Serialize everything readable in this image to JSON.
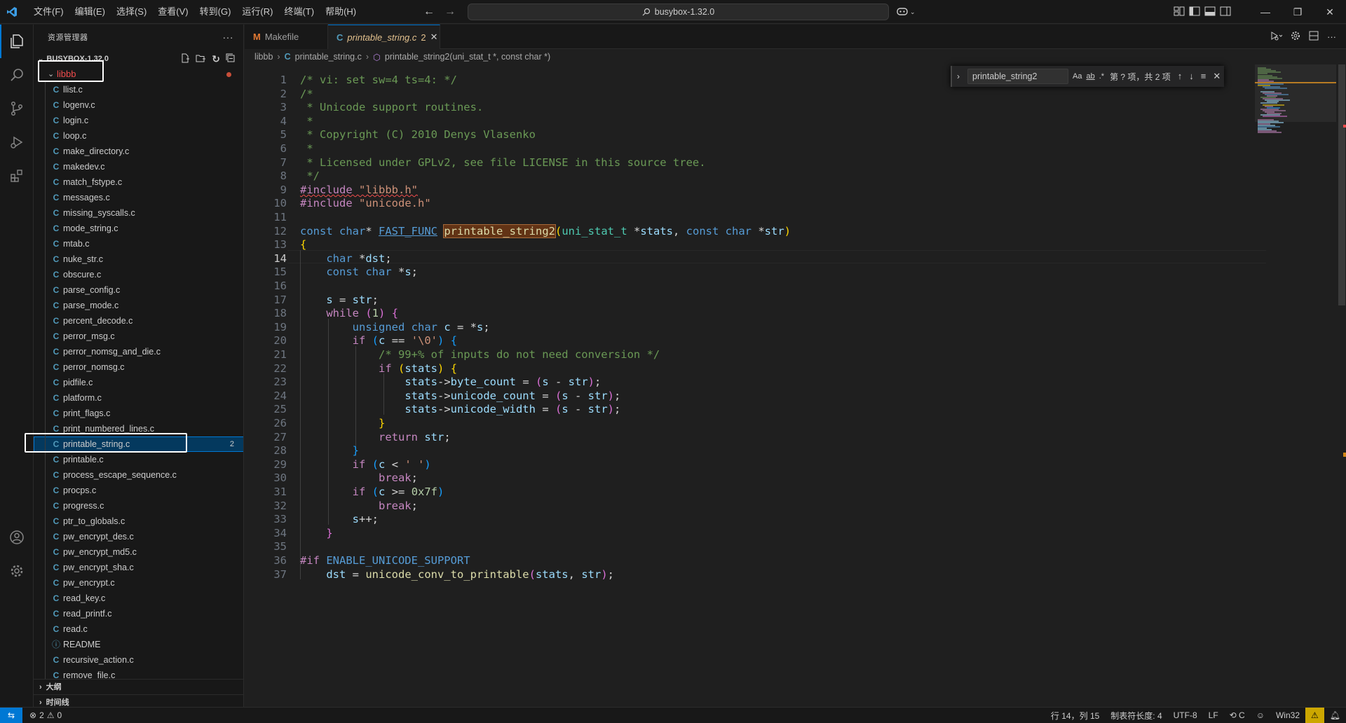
{
  "menu": [
    "文件(F)",
    "编辑(E)",
    "选择(S)",
    "查看(V)",
    "转到(G)",
    "运行(R)",
    "终端(T)",
    "帮助(H)"
  ],
  "command_center": {
    "text": "busybox-1.32.0"
  },
  "sidebar": {
    "title": "资源管理器",
    "root_folder": "BUSYBOX-1.32.0",
    "folder": "libbb",
    "files": [
      {
        "name": "llist.c",
        "type": "c"
      },
      {
        "name": "logenv.c",
        "type": "c"
      },
      {
        "name": "login.c",
        "type": "c"
      },
      {
        "name": "loop.c",
        "type": "c"
      },
      {
        "name": "make_directory.c",
        "type": "c"
      },
      {
        "name": "makedev.c",
        "type": "c"
      },
      {
        "name": "match_fstype.c",
        "type": "c"
      },
      {
        "name": "messages.c",
        "type": "c"
      },
      {
        "name": "missing_syscalls.c",
        "type": "c"
      },
      {
        "name": "mode_string.c",
        "type": "c"
      },
      {
        "name": "mtab.c",
        "type": "c"
      },
      {
        "name": "nuke_str.c",
        "type": "c"
      },
      {
        "name": "obscure.c",
        "type": "c"
      },
      {
        "name": "parse_config.c",
        "type": "c"
      },
      {
        "name": "parse_mode.c",
        "type": "c"
      },
      {
        "name": "percent_decode.c",
        "type": "c"
      },
      {
        "name": "perror_msg.c",
        "type": "c"
      },
      {
        "name": "perror_nomsg_and_die.c",
        "type": "c"
      },
      {
        "name": "perror_nomsg.c",
        "type": "c"
      },
      {
        "name": "pidfile.c",
        "type": "c"
      },
      {
        "name": "platform.c",
        "type": "c"
      },
      {
        "name": "print_flags.c",
        "type": "c"
      },
      {
        "name": "print_numbered_lines.c",
        "type": "c"
      },
      {
        "name": "printable_string.c",
        "type": "c",
        "selected": true,
        "badge": "2"
      },
      {
        "name": "printable.c",
        "type": "c"
      },
      {
        "name": "process_escape_sequence.c",
        "type": "c"
      },
      {
        "name": "procps.c",
        "type": "c"
      },
      {
        "name": "progress.c",
        "type": "c"
      },
      {
        "name": "ptr_to_globals.c",
        "type": "c"
      },
      {
        "name": "pw_encrypt_des.c",
        "type": "c"
      },
      {
        "name": "pw_encrypt_md5.c",
        "type": "c"
      },
      {
        "name": "pw_encrypt_sha.c",
        "type": "c"
      },
      {
        "name": "pw_encrypt.c",
        "type": "c"
      },
      {
        "name": "read_key.c",
        "type": "c"
      },
      {
        "name": "read_printf.c",
        "type": "c"
      },
      {
        "name": "read.c",
        "type": "c"
      },
      {
        "name": "README",
        "type": "info"
      },
      {
        "name": "recursive_action.c",
        "type": "c"
      },
      {
        "name": "remove_file.c",
        "type": "c"
      }
    ],
    "outline_label": "大纲",
    "timeline_label": "时间线"
  },
  "tabs": [
    {
      "label": "Makefile",
      "icon": "M",
      "active": false
    },
    {
      "label": "printable_string.c",
      "icon": "C",
      "active": true,
      "errors": "2"
    }
  ],
  "breadcrumb": [
    "libbb",
    "printable_string.c",
    "printable_string2(uni_stat_t *, const char *)"
  ],
  "find": {
    "query": "printable_string2",
    "opt_case": "Aa",
    "opt_word": "ab",
    "opt_regex": ".*",
    "count": "第 ? 项，共 2 项"
  },
  "editor": {
    "current_line": 14,
    "lines": [
      [
        [
          "t-com",
          "/* vi: set sw=4 ts=4: */"
        ]
      ],
      [
        [
          "t-com",
          "/*"
        ]
      ],
      [
        [
          "t-com",
          " * Unicode support routines."
        ]
      ],
      [
        [
          "t-com",
          " *"
        ]
      ],
      [
        [
          "t-com",
          " * Copyright (C) 2010 Denys Vlasenko"
        ]
      ],
      [
        [
          "t-com",
          " *"
        ]
      ],
      [
        [
          "t-com",
          " * Licensed under GPLv2, see file LICENSE in this source tree."
        ]
      ],
      [
        [
          "t-com",
          " */"
        ]
      ],
      [
        [
          "t-pre squiggle",
          "#include "
        ],
        [
          "t-str squiggle",
          "\"libbb.h\""
        ]
      ],
      [
        [
          "t-pre",
          "#include "
        ],
        [
          "t-str",
          "\"unicode.h\""
        ]
      ],
      [],
      [
        [
          "t-kw",
          "const "
        ],
        [
          "t-kw",
          "char"
        ],
        [
          "t-plain",
          "* "
        ],
        [
          "t-mac underline-link",
          "FAST_FUNC"
        ],
        [
          "t-plain",
          " "
        ],
        [
          "t-fn find-hl",
          "printable_string2"
        ],
        [
          "t-brk1",
          "("
        ],
        [
          "t-type",
          "uni_stat_t"
        ],
        [
          "t-plain",
          " *"
        ],
        [
          "t-var",
          "stats"
        ],
        [
          "t-plain",
          ", "
        ],
        [
          "t-kw",
          "const "
        ],
        [
          "t-kw",
          "char"
        ],
        [
          "t-plain",
          " *"
        ],
        [
          "t-var",
          "str"
        ],
        [
          "t-brk1",
          ")"
        ]
      ],
      [
        [
          "t-brk1",
          "{"
        ]
      ],
      [
        [
          "t-plain",
          "    "
        ],
        [
          "t-kw",
          "char"
        ],
        [
          "t-plain",
          " *"
        ],
        [
          "t-var",
          "dst"
        ],
        [
          "t-plain",
          ";"
        ]
      ],
      [
        [
          "t-plain",
          "    "
        ],
        [
          "t-kw",
          "const "
        ],
        [
          "t-kw",
          "char"
        ],
        [
          "t-plain",
          " *"
        ],
        [
          "t-var",
          "s"
        ],
        [
          "t-plain",
          ";"
        ]
      ],
      [],
      [
        [
          "t-plain",
          "    "
        ],
        [
          "t-var",
          "s"
        ],
        [
          "t-plain",
          " = "
        ],
        [
          "t-var",
          "str"
        ],
        [
          "t-plain",
          ";"
        ]
      ],
      [
        [
          "t-plain",
          "    "
        ],
        [
          "t-ctl",
          "while"
        ],
        [
          "t-plain",
          " "
        ],
        [
          "t-brk2",
          "("
        ],
        [
          "t-num",
          "1"
        ],
        [
          "t-brk2",
          ")"
        ],
        [
          "t-plain",
          " "
        ],
        [
          "t-brk2",
          "{"
        ]
      ],
      [
        [
          "t-plain",
          "        "
        ],
        [
          "t-kw",
          "unsigned "
        ],
        [
          "t-kw",
          "char"
        ],
        [
          "t-plain",
          " "
        ],
        [
          "t-var",
          "c"
        ],
        [
          "t-plain",
          " = *"
        ],
        [
          "t-var",
          "s"
        ],
        [
          "t-plain",
          ";"
        ]
      ],
      [
        [
          "t-plain",
          "        "
        ],
        [
          "t-ctl",
          "if"
        ],
        [
          "t-plain",
          " "
        ],
        [
          "t-brk3",
          "("
        ],
        [
          "t-var",
          "c"
        ],
        [
          "t-plain",
          " == "
        ],
        [
          "t-str",
          "'\\0'"
        ],
        [
          "t-brk3",
          ")"
        ],
        [
          "t-plain",
          " "
        ],
        [
          "t-brk3",
          "{"
        ]
      ],
      [
        [
          "t-plain",
          "            "
        ],
        [
          "t-com",
          "/* 99+% of inputs do not need conversion */"
        ]
      ],
      [
        [
          "t-plain",
          "            "
        ],
        [
          "t-ctl",
          "if"
        ],
        [
          "t-plain",
          " "
        ],
        [
          "t-brk1",
          "("
        ],
        [
          "t-var",
          "stats"
        ],
        [
          "t-brk1",
          ")"
        ],
        [
          "t-plain",
          " "
        ],
        [
          "t-brk1",
          "{"
        ]
      ],
      [
        [
          "t-plain",
          "                "
        ],
        [
          "t-var",
          "stats"
        ],
        [
          "t-plain",
          "->"
        ],
        [
          "t-var",
          "byte_count"
        ],
        [
          "t-plain",
          " = "
        ],
        [
          "t-brk2",
          "("
        ],
        [
          "t-var",
          "s"
        ],
        [
          "t-plain",
          " - "
        ],
        [
          "t-var",
          "str"
        ],
        [
          "t-brk2",
          ")"
        ],
        [
          "t-plain",
          ";"
        ]
      ],
      [
        [
          "t-plain",
          "                "
        ],
        [
          "t-var",
          "stats"
        ],
        [
          "t-plain",
          "->"
        ],
        [
          "t-var",
          "unicode_count"
        ],
        [
          "t-plain",
          " = "
        ],
        [
          "t-brk2",
          "("
        ],
        [
          "t-var",
          "s"
        ],
        [
          "t-plain",
          " - "
        ],
        [
          "t-var",
          "str"
        ],
        [
          "t-brk2",
          ")"
        ],
        [
          "t-plain",
          ";"
        ]
      ],
      [
        [
          "t-plain",
          "                "
        ],
        [
          "t-var",
          "stats"
        ],
        [
          "t-plain",
          "->"
        ],
        [
          "t-var",
          "unicode_width"
        ],
        [
          "t-plain",
          " = "
        ],
        [
          "t-brk2",
          "("
        ],
        [
          "t-var",
          "s"
        ],
        [
          "t-plain",
          " - "
        ],
        [
          "t-var",
          "str"
        ],
        [
          "t-brk2",
          ")"
        ],
        [
          "t-plain",
          ";"
        ]
      ],
      [
        [
          "t-plain",
          "            "
        ],
        [
          "t-brk1",
          "}"
        ]
      ],
      [
        [
          "t-plain",
          "            "
        ],
        [
          "t-ctl",
          "return"
        ],
        [
          "t-plain",
          " "
        ],
        [
          "t-var",
          "str"
        ],
        [
          "t-plain",
          ";"
        ]
      ],
      [
        [
          "t-plain",
          "        "
        ],
        [
          "t-brk3",
          "}"
        ]
      ],
      [
        [
          "t-plain",
          "        "
        ],
        [
          "t-ctl",
          "if"
        ],
        [
          "t-plain",
          " "
        ],
        [
          "t-brk3",
          "("
        ],
        [
          "t-var",
          "c"
        ],
        [
          "t-plain",
          " < "
        ],
        [
          "t-str",
          "' '"
        ],
        [
          "t-brk3",
          ")"
        ]
      ],
      [
        [
          "t-plain",
          "            "
        ],
        [
          "t-ctl",
          "break"
        ],
        [
          "t-plain",
          ";"
        ]
      ],
      [
        [
          "t-plain",
          "        "
        ],
        [
          "t-ctl",
          "if"
        ],
        [
          "t-plain",
          " "
        ],
        [
          "t-brk3",
          "("
        ],
        [
          "t-var",
          "c"
        ],
        [
          "t-plain",
          " >= "
        ],
        [
          "t-num",
          "0x7f"
        ],
        [
          "t-brk3",
          ")"
        ]
      ],
      [
        [
          "t-plain",
          "            "
        ],
        [
          "t-ctl",
          "break"
        ],
        [
          "t-plain",
          ";"
        ]
      ],
      [
        [
          "t-plain",
          "        "
        ],
        [
          "t-var",
          "s"
        ],
        [
          "t-plain",
          "++;"
        ]
      ],
      [
        [
          "t-plain",
          "    "
        ],
        [
          "t-brk2",
          "}"
        ]
      ],
      [],
      [
        [
          "t-pre",
          "#if "
        ],
        [
          "t-mac",
          "ENABLE_UNICODE_SUPPORT"
        ]
      ],
      [
        [
          "t-plain",
          "    "
        ],
        [
          "t-var",
          "dst"
        ],
        [
          "t-plain",
          " = "
        ],
        [
          "t-fn",
          "unicode_conv_to_printable"
        ],
        [
          "t-brk2",
          "("
        ],
        [
          "t-var",
          "stats"
        ],
        [
          "t-plain",
          ", "
        ],
        [
          "t-var",
          "str"
        ],
        [
          "t-brk2",
          ")"
        ],
        [
          "t-plain",
          ";"
        ]
      ]
    ]
  },
  "status": {
    "errors": "2",
    "warnings": "0",
    "position": "行 14，列 15",
    "tab_size": "制表符长度: 4",
    "encoding": "UTF-8",
    "eol": "LF",
    "language": "C",
    "platform": "Win32"
  },
  "colors": {
    "accent": "#0078d4",
    "error": "#f14c4c",
    "warning_badge": "#cca700"
  }
}
